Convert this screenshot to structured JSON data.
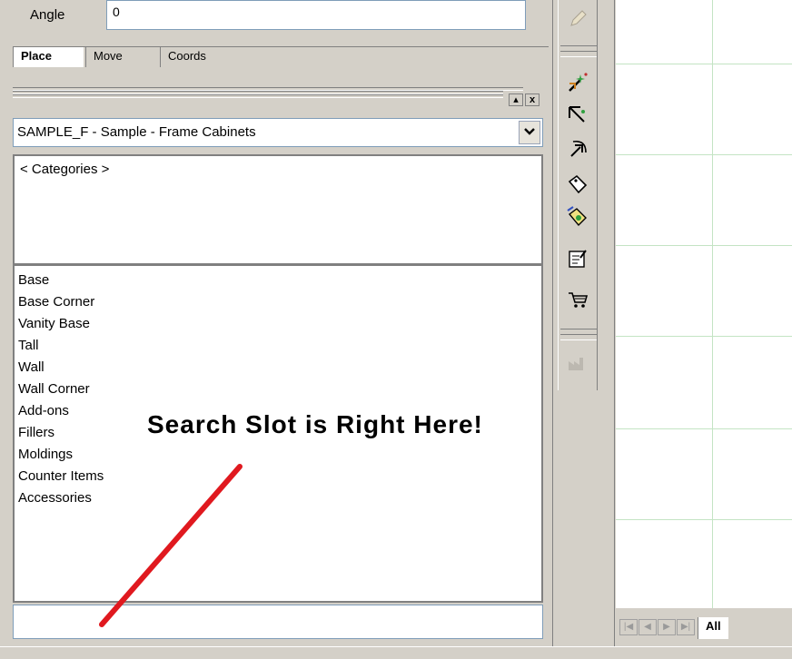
{
  "properties": {
    "angle_label": "Angle",
    "angle_value": "0"
  },
  "tabs": [
    "Place",
    "Move",
    "Coords"
  ],
  "catalog": {
    "selected": "SAMPLE_F - Sample - Frame Cabinets",
    "categories_header": "< Categories >",
    "items": [
      "Base",
      "Base Corner",
      "Vanity Base",
      "Tall",
      "Wall",
      "Wall Corner",
      "Add-ons",
      "Fillers",
      "Moldings",
      "Counter Items",
      "Accessories"
    ]
  },
  "search": {
    "value": ""
  },
  "annotation": {
    "text": "Search  Slot  is  Right  Here!",
    "color": "#e0191f"
  },
  "window_buttons": {
    "minimize": "▴",
    "close": "x"
  },
  "canvas_tabs": {
    "all": "All"
  },
  "toolbar_icons": [
    "pencil-icon",
    "magic-wand-icon",
    "select-arrow-icon",
    "rotate-arrow-icon",
    "tag-icon",
    "multi-tag-icon",
    "edit-sheet-icon",
    "shopping-cart-icon",
    "factory-icon"
  ],
  "colors": {
    "grid": "#c4e4c4",
    "panel": "#d4d0c8"
  }
}
